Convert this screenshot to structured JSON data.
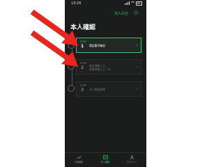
{
  "status_bar": {
    "time": "13:20"
  },
  "header": {
    "link_label": "法人の方"
  },
  "page": {
    "title": "本人確認"
  },
  "steps": [
    {
      "word": "STEP",
      "number": "1",
      "label": "電話番号確認",
      "active": true
    },
    {
      "word": "STEP",
      "number": "2",
      "label": "基本情報入力\n振替明細入力（※）",
      "active": false
    },
    {
      "word": "STEP",
      "number": "3",
      "label": "本人確認書類",
      "active": false
    }
  ],
  "tab_bar": {
    "items": [
      {
        "label": "口座開設",
        "icon": "chart-icon"
      },
      {
        "label": "本人確認",
        "icon": "id-card-icon",
        "active": true
      },
      {
        "label": "アカウント",
        "icon": "user-icon"
      }
    ]
  },
  "colors": {
    "accent": "#3cc46e",
    "arrow": "#e8251f",
    "background": "#1b1d1d"
  }
}
